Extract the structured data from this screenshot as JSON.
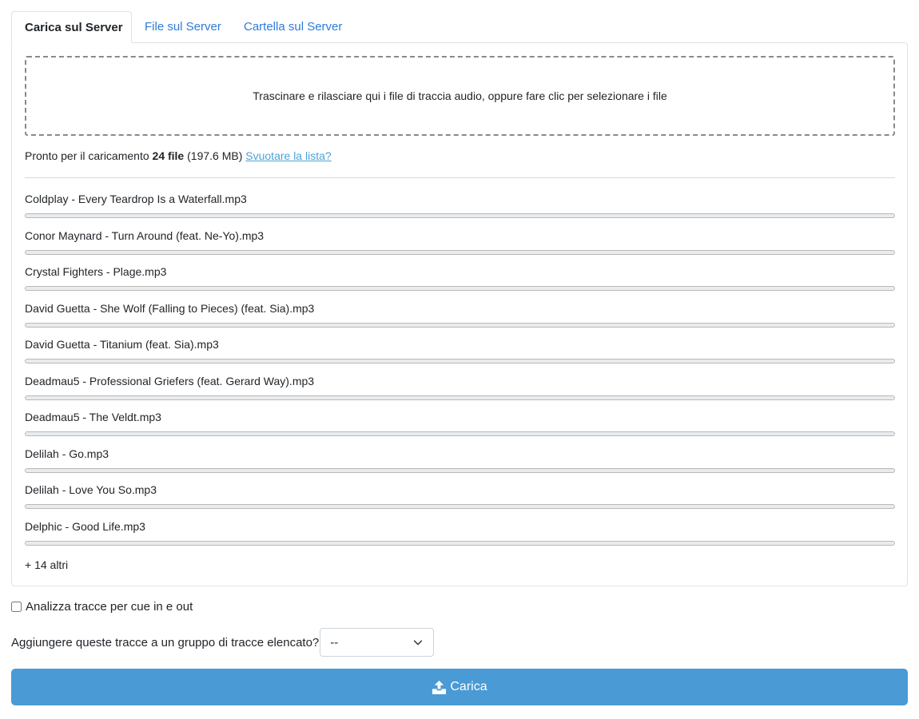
{
  "tabs": [
    {
      "label": "Carica sul Server",
      "active": true
    },
    {
      "label": "File sul Server",
      "active": false
    },
    {
      "label": "Cartella sul Server",
      "active": false
    }
  ],
  "dropzone": {
    "text": "Trascinare e rilasciare qui i file di traccia audio, oppure fare clic per selezionare i file"
  },
  "status": {
    "prefix": "Pronto per il caricamento",
    "count": "24 file",
    "size": "(197.6 MB)",
    "clear_link": "Svuotare la lista?"
  },
  "files": [
    {
      "name": "Coldplay - Every Teardrop Is a Waterfall.mp3",
      "progress": 0
    },
    {
      "name": "Conor Maynard - Turn Around (feat. Ne-Yo).mp3",
      "progress": 0
    },
    {
      "name": "Crystal Fighters - Plage.mp3",
      "progress": 0
    },
    {
      "name": "David Guetta - She Wolf (Falling to Pieces) (feat. Sia).mp3",
      "progress": 0
    },
    {
      "name": "David Guetta - Titanium (feat. Sia).mp3",
      "progress": 0
    },
    {
      "name": "Deadmau5 - Professional Griefers (feat. Gerard Way).mp3",
      "progress": 0
    },
    {
      "name": "Deadmau5 - The Veldt.mp3",
      "progress": 0
    },
    {
      "name": "Delilah - Go.mp3",
      "progress": 0
    },
    {
      "name": "Delilah - Love You So.mp3",
      "progress": 0
    },
    {
      "name": "Delphic - Good Life.mp3",
      "progress": 0
    }
  ],
  "more_label": "+ 14 altri",
  "analyze": {
    "label": "Analizza tracce per cue in e out",
    "checked": false
  },
  "group": {
    "label": "Aggiungere queste tracce a un gruppo di tracce elencato?",
    "selected": "--"
  },
  "upload_button": {
    "label": "Carica",
    "icon": "upload-icon"
  },
  "colors": {
    "accent": "#4a9ad6",
    "link": "#2f7bd9"
  }
}
